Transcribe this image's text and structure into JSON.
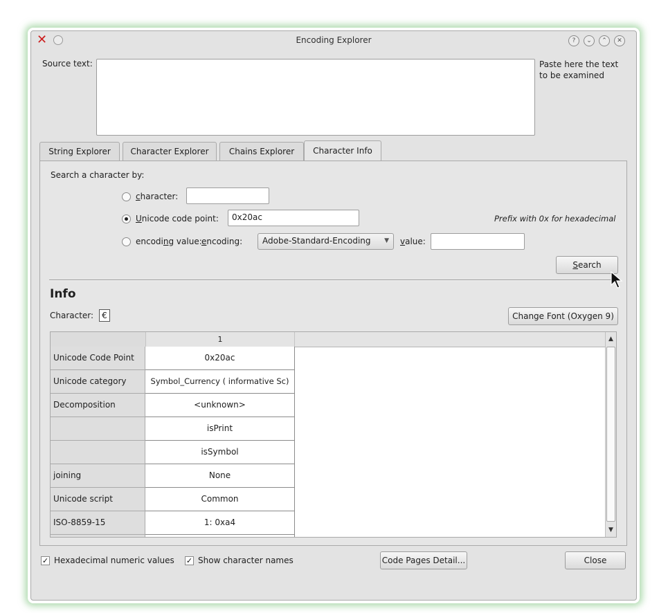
{
  "window": {
    "title": "Encoding Explorer"
  },
  "source": {
    "label": "Source text:",
    "hint": "Paste here the text to be examined",
    "value": ""
  },
  "tabs": [
    {
      "label": "String Explorer"
    },
    {
      "label": "Character Explorer"
    },
    {
      "label": "Chains Explorer"
    },
    {
      "label": "Character Info",
      "active": true
    }
  ],
  "search": {
    "title": "Search a character by:",
    "character_label": "character:",
    "character_value": "",
    "codepoint_label": "Unicode code point:",
    "codepoint_value": "0x20ac",
    "codepoint_hint": "Prefix with 0x for hexadecimal",
    "encoding_value_label": "encoding value:",
    "encoding_label": "encoding:",
    "encoding_selected": "Adobe-Standard-Encoding",
    "value_label": "value:",
    "value_value": "",
    "search_button": "Search"
  },
  "info": {
    "heading": "Info",
    "character_label": "Character:",
    "character_value": "€",
    "change_font_button": "Change Font (Oxygen  9)",
    "column_header": "1",
    "rows": [
      {
        "label": "Unicode Code Point",
        "value": "0x20ac"
      },
      {
        "label": "Unicode category",
        "value": "Symbol_Currency ( informative Sc)"
      },
      {
        "label": "Decomposition",
        "value": "<unknown>"
      },
      {
        "label": "",
        "value": "isPrint"
      },
      {
        "label": "",
        "value": "isSymbol"
      },
      {
        "label": "joining",
        "value": "None"
      },
      {
        "label": "Unicode script",
        "value": "Common"
      },
      {
        "label": "ISO-8859-15",
        "value": "1: 0xa4"
      }
    ]
  },
  "footer": {
    "hex_label": "Hexadecimal numeric values",
    "hex_checked": true,
    "names_label": "Show character names",
    "names_checked": true,
    "code_pages_button": "Code Pages Detail...",
    "close_button": "Close"
  }
}
